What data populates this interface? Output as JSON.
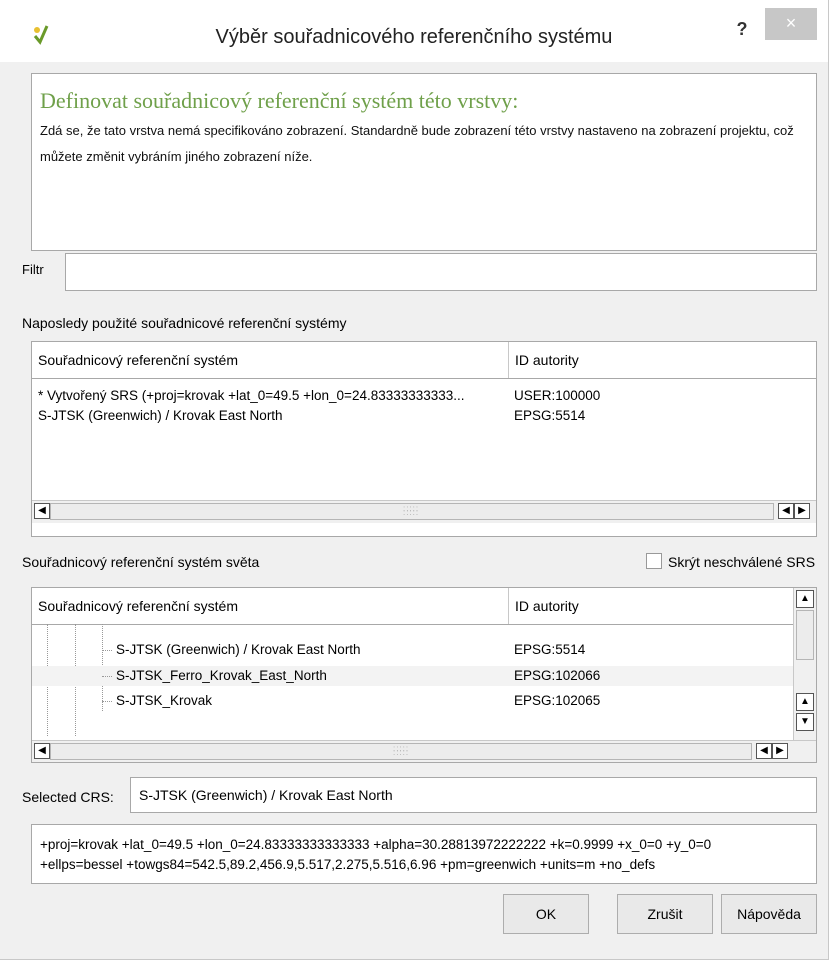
{
  "window": {
    "title": "Výběr souřadnicového referenčního systému",
    "help_label": "?",
    "close_label": "×"
  },
  "info": {
    "title": "Definovat souřadnicový referenční systém této vrstvy:",
    "body": "Zdá se, že tato vrstva nemá specifikováno zobrazení. Standardně bude zobrazení této vrstvy nastaveno na zobrazení projektu, což můžete změnit vybráním jiného zobrazení níže."
  },
  "filter": {
    "label": "Filtr",
    "value": ""
  },
  "recent": {
    "label": "Naposledy použité souřadnicové referenční systémy",
    "columns": [
      "Souřadnicový referenční systém",
      "ID autority"
    ],
    "rows": [
      {
        "name": " * Vytvořený SRS (+proj=krovak +lat_0=49.5 +lon_0=24.83333333333...",
        "id": "USER:100000"
      },
      {
        "name": "S-JTSK (Greenwich) / Krovak East North",
        "id": "EPSG:5514"
      }
    ]
  },
  "world": {
    "label": "Souřadnicový referenční systém světa",
    "hide_label": "Skrýt neschválené SRS",
    "hide_checked": false,
    "columns": [
      "Souřadnicový referenční systém",
      "ID autority"
    ],
    "rows": [
      {
        "name": "S-JTSK (Greenwich) / Krovak East North",
        "id": "EPSG:5514"
      },
      {
        "name": "S-JTSK_Ferro_Krovak_East_North",
        "id": "EPSG:102066"
      },
      {
        "name": "S-JTSK_Krovak",
        "id": "EPSG:102065"
      }
    ]
  },
  "selected": {
    "label": "Selected CRS:",
    "value": "S-JTSK (Greenwich) / Krovak East North"
  },
  "proj_string": {
    "line1": "+proj=krovak +lat_0=49.5 +lon_0=24.83333333333333 +alpha=30.28813972222222 +k=0.9999 +x_0=0 +y_0=0",
    "line2": "+ellps=bessel +towgs84=542.5,89.2,456.9,5.517,2.275,5.516,6.96 +pm=greenwich +units=m +no_defs"
  },
  "buttons": {
    "ok": "OK",
    "cancel": "Zrušit",
    "help": "Nápověda"
  },
  "colors": {
    "info_title": "#6fa04a",
    "close_bg": "#c7c7c7"
  }
}
